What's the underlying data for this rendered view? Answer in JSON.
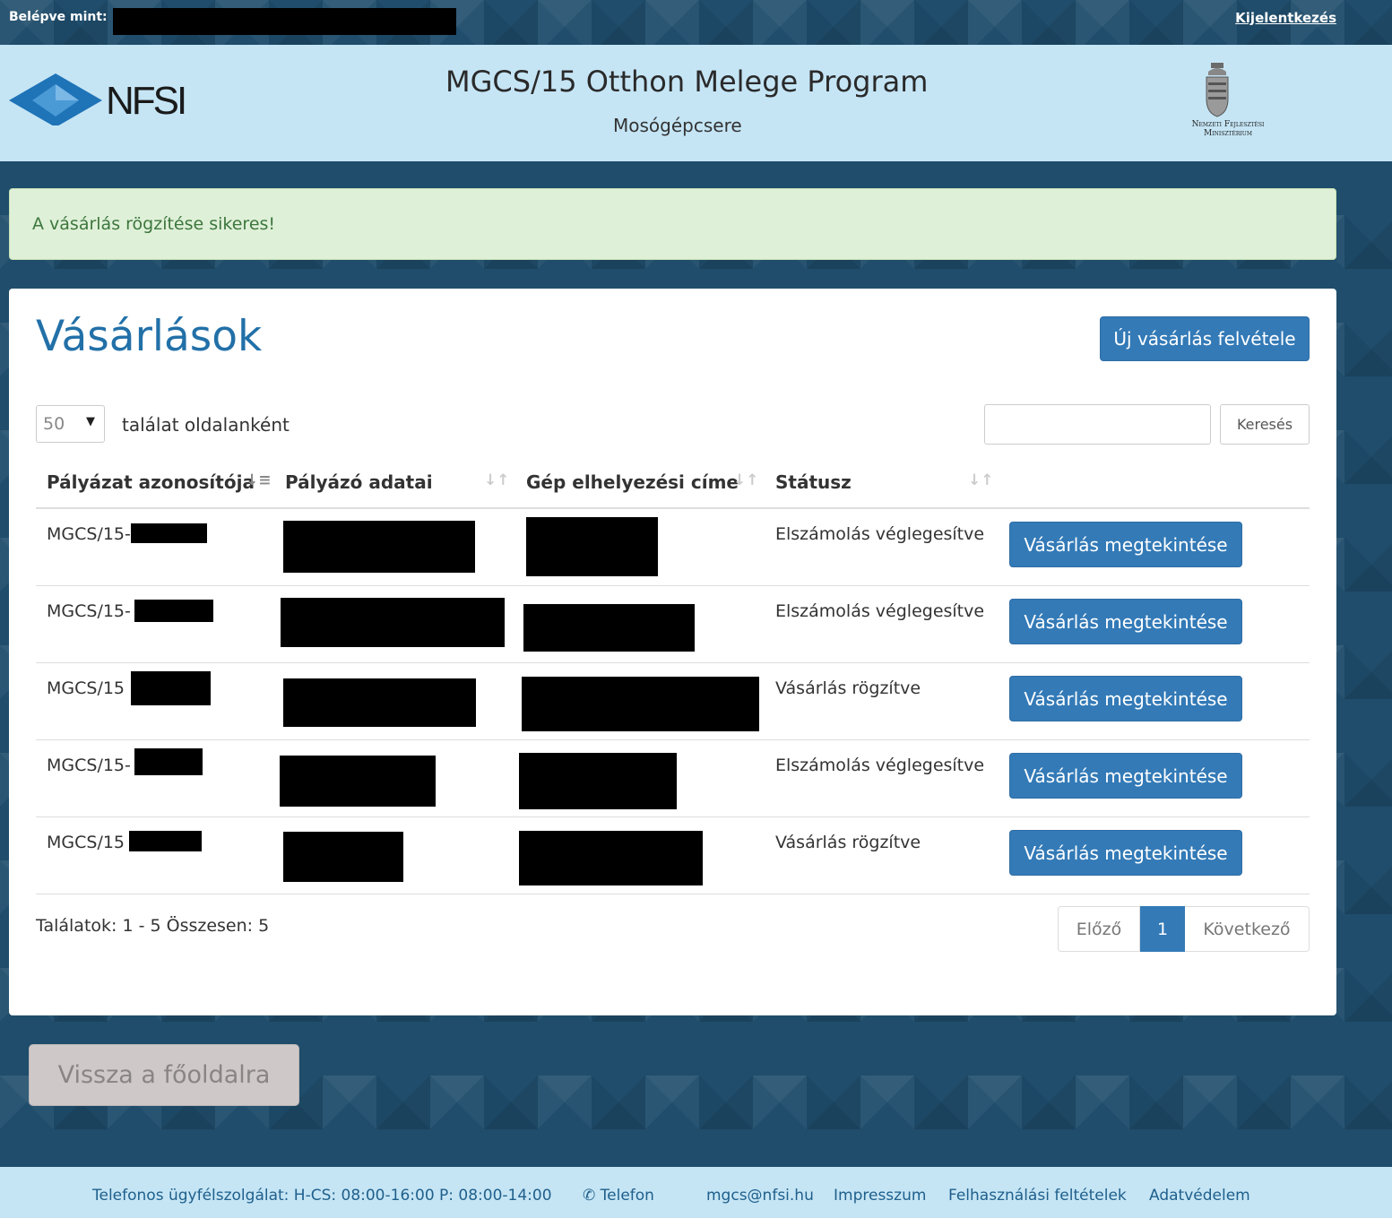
{
  "topbar": {
    "logged_in_label": "Belépve mint:",
    "logout": "Kijelentkezés"
  },
  "header": {
    "logo_text": "NFSI",
    "title": "MGCS/15 Otthon Melege Program",
    "subtitle": "Mosógépcsere",
    "ministry_line1": "Nemzeti Fejlesztési",
    "ministry_line2": "Minisztérium"
  },
  "alert": {
    "message": "A vásárlás rögzítése sikeres!"
  },
  "main": {
    "heading": "Vásárlások",
    "new_button": "Új vásárlás felvétele",
    "page_size": "50",
    "per_page_label": "találat oldalanként",
    "search_button": "Keresés",
    "search_value": "",
    "columns": [
      "Pályázat azonosítója",
      "Pályázó adatai",
      "Gép elhelyezési címe",
      "Státusz"
    ],
    "rows": [
      {
        "id_prefix": "MGCS/15-",
        "status": "Elszámolás véglegesítve",
        "action": "Vásárlás megtekintése"
      },
      {
        "id_prefix": "MGCS/15-",
        "status": "Elszámolás véglegesítve",
        "action": "Vásárlás megtekintése"
      },
      {
        "id_prefix": "MGCS/15",
        "status": "Vásárlás rögzítve",
        "action": "Vásárlás megtekintése"
      },
      {
        "id_prefix": "MGCS/15-",
        "status": "Elszámolás véglegesítve",
        "action": "Vásárlás megtekintése"
      },
      {
        "id_prefix": "MGCS/15",
        "status": "Vásárlás rögzítve",
        "action": "Vásárlás megtekintése"
      }
    ],
    "results_text": "Találatok: 1 - 5 Összesen: 5",
    "pager": {
      "prev": "Előző",
      "current": "1",
      "next": "Következő"
    }
  },
  "back_button": "Vissza a főoldalra",
  "footer": {
    "phone_service": "Telefonos ügyfélszolgálat: H-CS: 08:00-16:00 P: 08:00-14:00",
    "phone_link": "Telefon",
    "email": "mgcs@nfsi.hu",
    "impresszum": "Impresszum",
    "terms": "Felhasználási feltételek",
    "privacy": "Adatvédelem"
  },
  "colors": {
    "primary": "#337ab7",
    "header_bg": "#c5e5f5",
    "page_bg": "#1f4d6b",
    "alert_bg": "#dff0d8",
    "alert_text": "#3c763d"
  }
}
